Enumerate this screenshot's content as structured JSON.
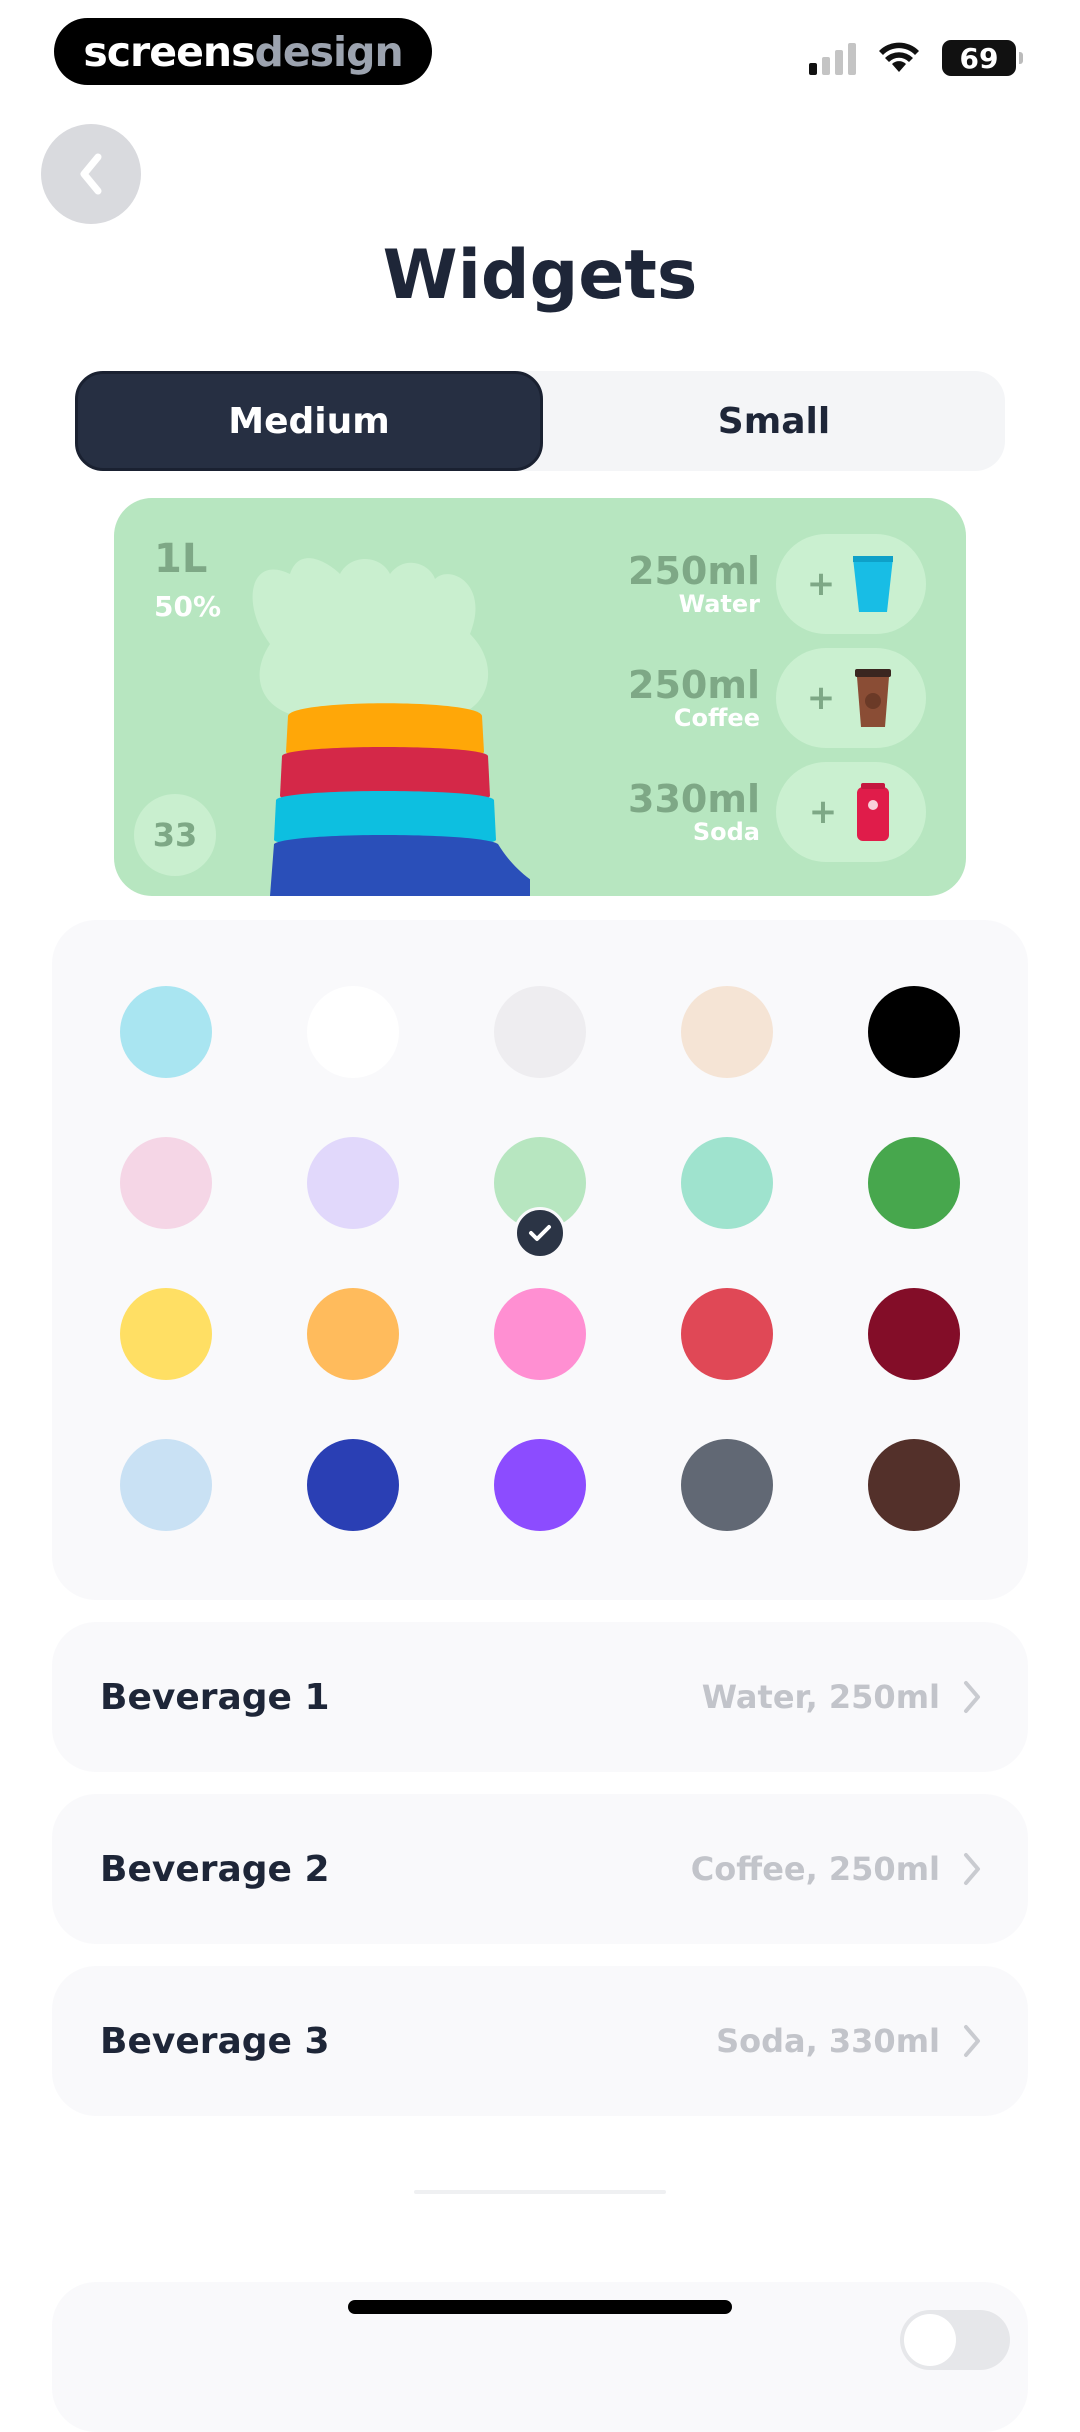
{
  "status_bar": {
    "logo_left": "screens",
    "logo_right": "design",
    "battery": "69"
  },
  "header": {
    "title": "Widgets"
  },
  "size_toggle": {
    "options": [
      "Medium",
      "Small"
    ],
    "selected": "Medium"
  },
  "widget_preview": {
    "total": "1L",
    "percent": "50%",
    "streak": "33",
    "background": "#b7e6c0",
    "beverages": [
      {
        "amount": "250ml",
        "name": "Water",
        "icon": "water-cup-icon"
      },
      {
        "amount": "250ml",
        "name": "Coffee",
        "icon": "coffee-cup-icon"
      },
      {
        "amount": "330ml",
        "name": "Soda",
        "icon": "soda-can-icon"
      }
    ],
    "plus": "+"
  },
  "colors": {
    "swatches": [
      "#a9e5f1",
      "#ffffff",
      "#eeedf0",
      "#f5e4d5",
      "#000000",
      "#f5d6e6",
      "#e1d8fb",
      "#b7e6c0",
      "#9fe3ce",
      "#47a74d",
      "#ffdf64",
      "#ffbb5c",
      "#ff8fd2",
      "#e04856",
      "#830d28",
      "#c9e1f4",
      "#2a3fb4",
      "#8c4cff",
      "#616874",
      "#53302a"
    ],
    "selected_index": 7
  },
  "beverage_settings": [
    {
      "label": "Beverage 1",
      "value": "Water, 250ml"
    },
    {
      "label": "Beverage 2",
      "value": "Coffee, 250ml"
    },
    {
      "label": "Beverage 3",
      "value": "Soda, 330ml"
    }
  ]
}
